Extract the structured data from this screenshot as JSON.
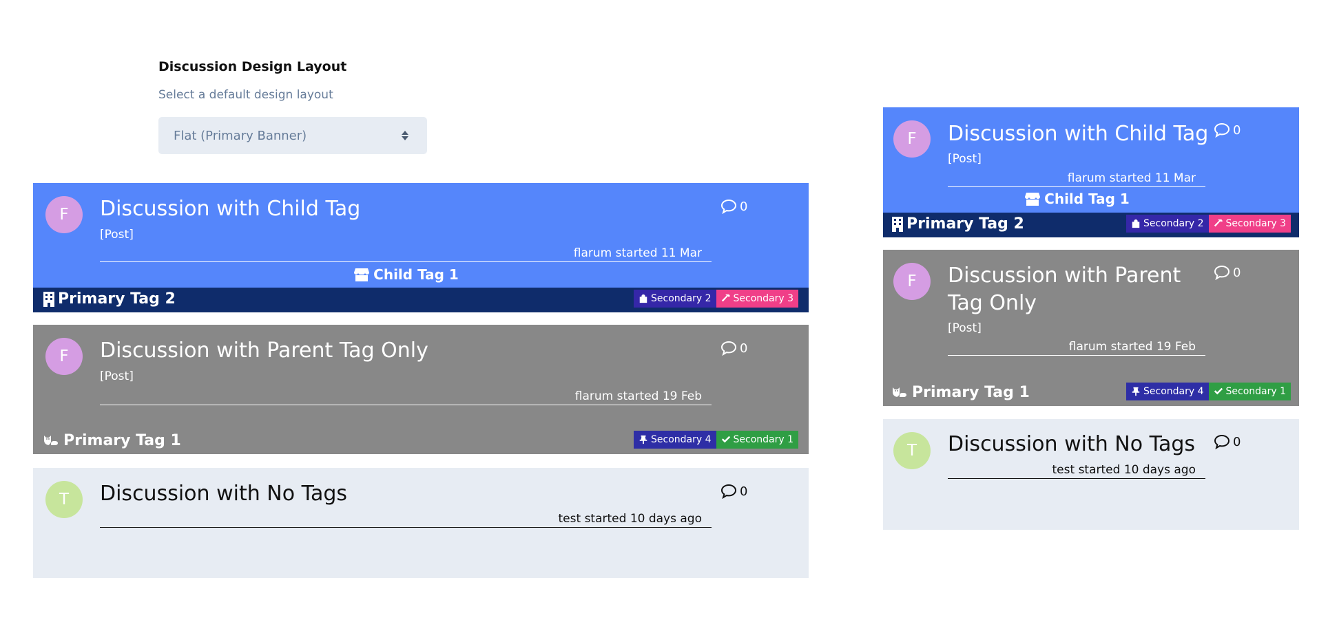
{
  "setting": {
    "title": "Discussion Design Layout",
    "help": "Select a default design layout",
    "selected": "Flat (Primary Banner)"
  },
  "discussions": [
    {
      "avatar_letter": "F",
      "avatar_color": "#d59de3",
      "title": "Discussion with Child Tag",
      "post": "[Post]",
      "replies": "0",
      "meta": "flarum started 11 Mar",
      "background": "#5586fb",
      "child_tag": {
        "label": "Child Tag 1",
        "icon": "store-icon"
      },
      "primary_tag": {
        "label": "Primary Tag 2",
        "icon": "building-icon",
        "color": "#0f2c6b"
      },
      "secondary_tags": [
        {
          "label": "Secondary 2",
          "icon": "bag-icon",
          "color": "#3527a8"
        },
        {
          "label": "Secondary 3",
          "icon": "hammer-icon",
          "color": "#f03f88"
        }
      ]
    },
    {
      "avatar_letter": "F",
      "avatar_color": "#d59de3",
      "title": "Discussion with Parent Tag Only",
      "post": "[Post]",
      "replies": "0",
      "meta": "flarum started 19 Feb",
      "background": "#888888",
      "primary_tag": {
        "label": "Primary Tag 1",
        "icon": "cat-icon",
        "color": "#888888"
      },
      "secondary_tags": [
        {
          "label": "Secondary 4",
          "icon": "pin-icon",
          "color": "#2e2ea6"
        },
        {
          "label": "Secondary 1",
          "icon": "check-icon",
          "color": "#2f9e44"
        }
      ]
    },
    {
      "avatar_letter": "T",
      "avatar_color": "#c7e59c",
      "title": "Discussion with No Tags",
      "replies": "0",
      "meta": "test started 10 days ago",
      "background": "#e7ecf3"
    }
  ]
}
